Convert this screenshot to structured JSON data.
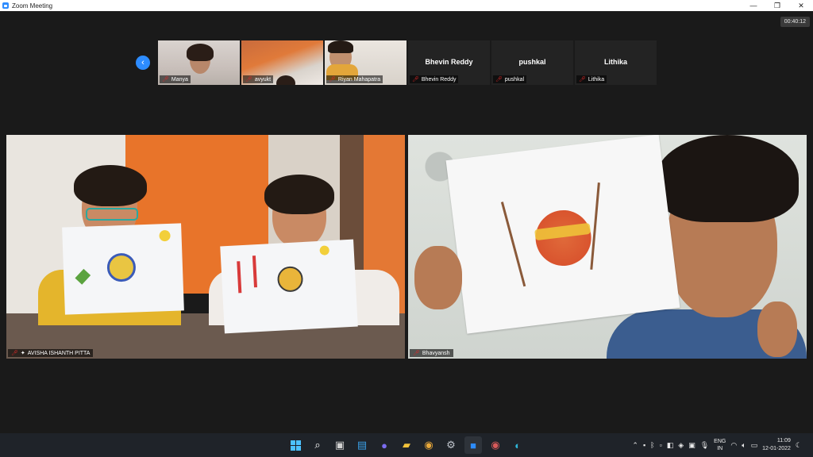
{
  "window": {
    "title": "Zoom Meeting",
    "minimize": "—",
    "maximize": "❐",
    "close": "✕"
  },
  "meeting": {
    "timer": "00:40:12",
    "gallery_strip": [
      {
        "name": "Manya",
        "has_video": true
      },
      {
        "name": "avyukt",
        "has_video": true
      },
      {
        "name": "Riyan Mahapatra",
        "has_video": true
      },
      {
        "name": "Bhevin Reddy",
        "has_video": false
      },
      {
        "name": "pushkal",
        "has_video": false
      },
      {
        "name": "Lithika",
        "has_video": false
      }
    ],
    "main_tiles": [
      {
        "name": "AVISHA ISHANTH  PITTA"
      },
      {
        "name": "Bhavyansh"
      }
    ]
  },
  "taskbar": {
    "tray": {
      "lang_top": "ENG",
      "lang_bottom": "IN",
      "time": "11:09",
      "date": "12-01-2022"
    }
  },
  "colors": {
    "accent": "#2d8cff",
    "mic_muted": "#e02828",
    "background": "#1a1a1a"
  }
}
